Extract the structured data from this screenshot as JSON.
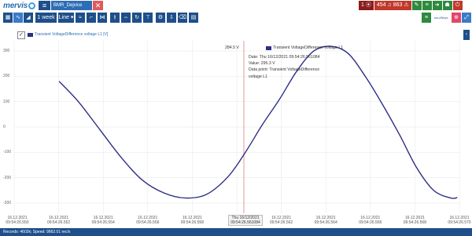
{
  "header": {
    "logo_text": "mervis",
    "hamburger": "≡",
    "file_tab": "BMR_Dejvice",
    "close_symbol": "✕"
  },
  "alarms": {
    "count_a": "1",
    "count_b": "454",
    "count_c": "863"
  },
  "toolbar": {
    "range_label": "1 week",
    "mode_label": "Line",
    "mode_arrow": "▾",
    "range_arrow": "▾",
    "sidebar_label": "≡",
    "right_label": "ms-l/Nepr.",
    "zoom_symbol": "⊕"
  },
  "legend": {
    "checkbox": "✓",
    "series_label": "Transient VoltageDifference voltage L1 [V]"
  },
  "y_axis": {
    "ticks": [
      "300",
      "200",
      "100",
      "0",
      "-100",
      "-200",
      "-300"
    ]
  },
  "x_axis": {
    "ticks": [
      {
        "date": "16.12.2021",
        "time": "09:54:26.550"
      },
      {
        "date": "16.12.2021",
        "time": "09:54:26.552"
      },
      {
        "date": "16.12.2021",
        "time": "09:54:26.554"
      },
      {
        "date": "16.12.2021",
        "time": "09:54:26.556"
      },
      {
        "date": "16.12.2021",
        "time": "09:54:26.558"
      },
      {
        "date": "16.12.2021",
        "time": "09:54:26.560"
      },
      {
        "date": "16.12.2021",
        "time": "09:54:26.562"
      },
      {
        "date": "16.12.2021",
        "time": "09:54:26.564"
      },
      {
        "date": "16.12.2021",
        "time": "09:54:26.566"
      },
      {
        "date": "16.12.2021",
        "time": "09:54:26.568"
      },
      {
        "date": "16.12.2021",
        "time": "09:54:26.570"
      }
    ],
    "hover_date": "Thu 16/12/2021",
    "hover_time": "09:54:26.561084"
  },
  "tooltip": {
    "value_tag": "284.5 V",
    "series": "Transient VoltageDifference voltage L1",
    "date_line": "Date: Thu 16/12/2021 09:54:26.561084",
    "value_line": "Value: 295.3 V",
    "point_line_1": "Data point: Transient VoltageDifference",
    "point_line_2": "voltage L1"
  },
  "status": {
    "text": "Records: 4602k; Speed: 9862.01 rec/s"
  },
  "colors": {
    "primary": "#1e4f8a",
    "series": "#2d2f86",
    "crosshair": "#d9534f",
    "grid": "#e6e6e6"
  },
  "chart_data": {
    "type": "line",
    "title": "",
    "xlabel": "",
    "ylabel": "",
    "ylim": [
      -340,
      340
    ],
    "x_unit": "ms offset from 09:54:26.550",
    "series": [
      {
        "name": "Transient VoltageDifference voltage L1 [V]",
        "x": [
          1.05,
          1.5,
          2.0,
          2.5,
          3.0,
          3.5,
          4.0,
          4.5,
          5.0,
          5.4,
          5.8,
          6.2,
          6.6,
          7.0,
          7.4,
          7.8,
          8.2,
          8.6,
          9.0,
          9.4,
          9.8,
          10.2,
          10.35
        ],
        "values": [
          180,
          100,
          -10,
          -120,
          -210,
          -260,
          -280,
          -265,
          -195,
          -100,
          10,
          110,
          220,
          300,
          318,
          290,
          200,
          90,
          -30,
          -160,
          -250,
          -280,
          -278
        ]
      }
    ]
  }
}
